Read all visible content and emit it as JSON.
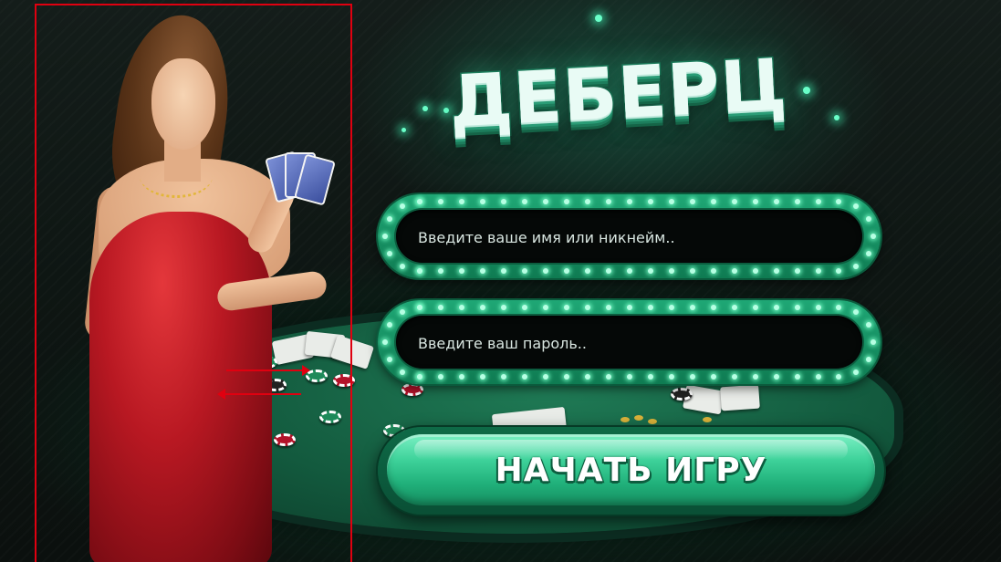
{
  "game": {
    "logo_text": "ДЕБЕРЦ"
  },
  "login_form": {
    "name_field": {
      "placeholder": "Введите ваше имя или никнейм..",
      "value": ""
    },
    "password_field": {
      "placeholder": "Введите ваш пароль..",
      "value": ""
    },
    "start_button_label": "НАЧАТЬ ИГРУ"
  },
  "colors": {
    "accent_green": "#20b07a",
    "frame_green": "#1fa775",
    "annotation_red": "#e00010",
    "dress_red": "#b81822"
  },
  "icons": {
    "lights": "marquee-light-icon",
    "cards": "playing-cards-icon",
    "chips": "poker-chip-icon"
  }
}
